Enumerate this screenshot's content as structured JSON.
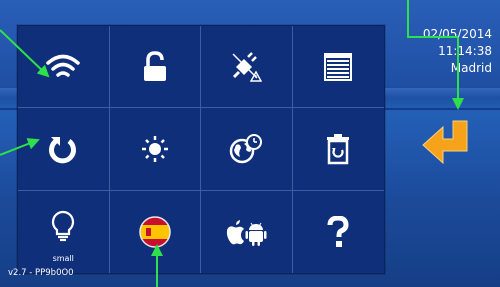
{
  "status": {
    "date": "02/05/2014",
    "time": "11:14:38",
    "city": "Madrid"
  },
  "version": "v2.7 - PP9b0O0",
  "grid": {
    "rows": [
      [
        "wifi-icon",
        "unlock-icon",
        "power-warning-icon",
        "blinds-icon"
      ],
      [
        "refresh-icon",
        "brightness-icon",
        "world-clock-icon",
        "trash-icon"
      ],
      [
        "bulb-icon",
        "spain-flag-icon",
        "apple-android-icon",
        "help-icon"
      ]
    ],
    "bulb_label": "small"
  },
  "colors": {
    "background": "#1e4fa3",
    "panel": "#0f2f7a",
    "enter_arrow": "#f7a21b",
    "annotation": "#2ee04a"
  }
}
